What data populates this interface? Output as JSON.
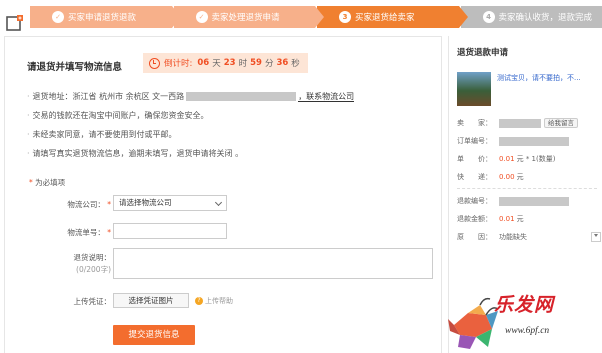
{
  "steps": [
    {
      "number": "✓",
      "label": "买家申请退货退款",
      "state": "done"
    },
    {
      "number": "✓",
      "label": "卖家处理退货申请",
      "state": "done"
    },
    {
      "number": "3",
      "label": "买家退货给卖家",
      "state": "active"
    },
    {
      "number": "4",
      "label": "卖家确认收货，退款完成",
      "state": "todo"
    }
  ],
  "main": {
    "title": "请退货并填写物流信息",
    "countdown": {
      "prefix": "倒计时:",
      "days": "06",
      "days_unit": "天",
      "hours": "23",
      "hours_unit": "时",
      "minutes": "59",
      "minutes_unit": "分",
      "seconds": "36",
      "seconds_unit": "秒"
    },
    "notes": [
      {
        "prefix": "退货地址：浙江省 杭州市 余杭区 文一西路",
        "suffix": "，联系物流公司"
      },
      {
        "text": "交易的钱款还在淘宝中间账户，确保您资金安全。"
      },
      {
        "text": "未经卖家同意，请不要使用到付或平邮。"
      },
      {
        "text": "请填写真实退货物流信息，逾期未填写，退货申请将关闭 。"
      }
    ],
    "required_hint": "为必填项",
    "form": {
      "company_label": "物流公司：",
      "company_value": "请选择物流公司",
      "tracking_label": "物流单号：",
      "note_label": "退货说明：",
      "note_counter": "(0/200字)",
      "voucher_label": "上传凭证：",
      "voucher_button": "选择凭证图片",
      "upload_help": "上传帮助",
      "submit": "提交退货信息"
    }
  },
  "sidebar": {
    "title": "退货退款申请",
    "product_name": "测试宝贝，请不要拍，不...",
    "seller_key": "卖　　家：",
    "message_button": "给我留言",
    "order_key": "订单编号：",
    "price_key": "单　　价：",
    "price_value": "0.01",
    "price_unit": "元 * 1(数量)",
    "shipping_key": "快　　递：",
    "shipping_value": "0.00",
    "shipping_unit": "元",
    "refund_no_key": "退款编号：",
    "refund_amount_key": "退款金额：",
    "refund_amount_value": "0.01",
    "refund_amount_unit": "元",
    "reason_key": "原　　因：",
    "reason_value": "功能缺失"
  },
  "watermark": {
    "text": "乐发网",
    "url": "www.6pf.cn"
  },
  "colors": {
    "accent": "#f36d2e",
    "step_done": "#f7b08a",
    "step_active": "#f08030",
    "step_todo": "#bdbdbd",
    "highlight": "#f04e23"
  }
}
